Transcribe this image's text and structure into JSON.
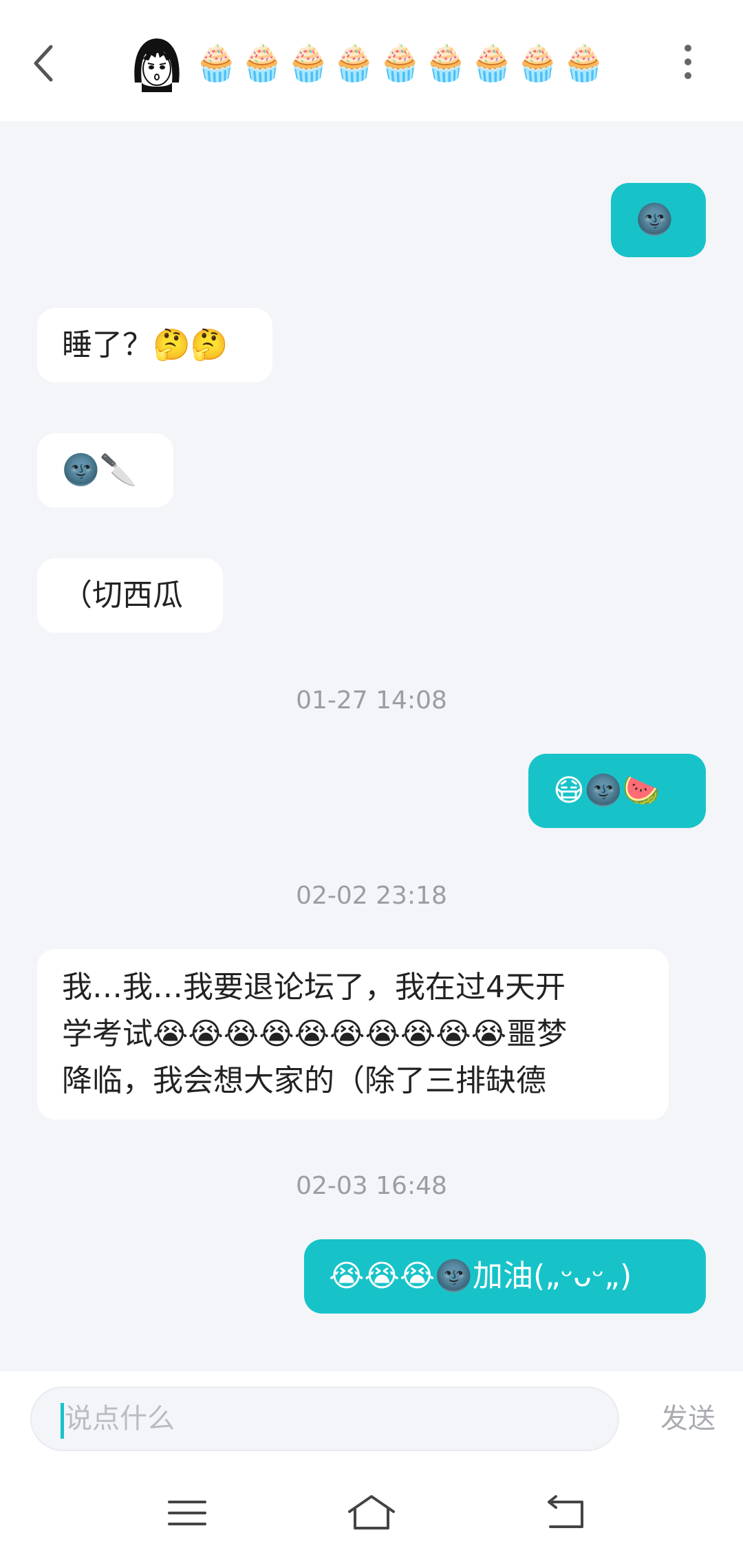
{
  "header": {
    "title": "🧁🧁🧁🧁🧁🧁🧁🧁🧁",
    "back_icon": "chevron-left-icon",
    "more_icon": "more-vertical-icon",
    "avatar": "manga-girl-avatar"
  },
  "colors": {
    "accent": "#17c3c9",
    "background": "#f3f5f8",
    "incoming_bubble": "#ffffff",
    "timestamp": "#9a9da3"
  },
  "messages": {
    "m0": {
      "direction": "incoming",
      "text": ""
    },
    "m1": {
      "direction": "outgoing",
      "text": "🌚"
    },
    "m2": {
      "direction": "incoming",
      "text": "睡了？🤔🤔"
    },
    "m3": {
      "direction": "incoming",
      "text": "🌚🔪"
    },
    "m4": {
      "direction": "incoming",
      "text": "（切西瓜"
    },
    "ts1": "01-27 14:08",
    "m5": {
      "direction": "outgoing",
      "text": "😷🌚🍉"
    },
    "ts2": "02-02 23:18",
    "m6": {
      "direction": "incoming",
      "lines": [
        "我…我…我要退论坛了，我在过4天开",
        "学考试😭😭😭😭😭😭😭😭😭😭噩梦",
        "降临，我会想大家的（除了三排缺德"
      ]
    },
    "ts3": "02-03 16:48",
    "m7": {
      "direction": "outgoing",
      "text": "😭😭😭🌚加油(„ᵕᴗᵕ„)"
    }
  },
  "input": {
    "placeholder": "说点什么",
    "value": "",
    "send_label": "发送"
  },
  "navbar": {
    "menu_icon": "menu-icon",
    "home_icon": "home-icon",
    "back_icon": "back-arrow-icon"
  }
}
